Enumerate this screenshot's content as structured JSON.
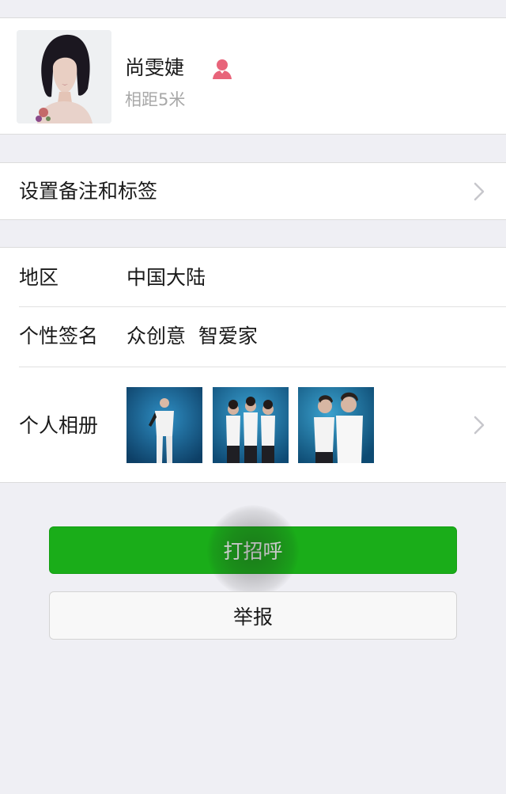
{
  "profile": {
    "name": "尚雯婕",
    "distance": "相距5米",
    "gender_icon": "female-person-icon",
    "gender_icon_color": "#e8647a"
  },
  "remark_row": {
    "label": "设置备注和标签"
  },
  "info": {
    "region_label": "地区",
    "region_value": "中国大陆",
    "signature_label": "个性签名",
    "signature_value": "众创意  智爱家",
    "album_label": "个人相册"
  },
  "buttons": {
    "greet": "打招呼",
    "report": "举报"
  },
  "colors": {
    "accent_green": "#1aad19",
    "background": "#efeff4"
  }
}
